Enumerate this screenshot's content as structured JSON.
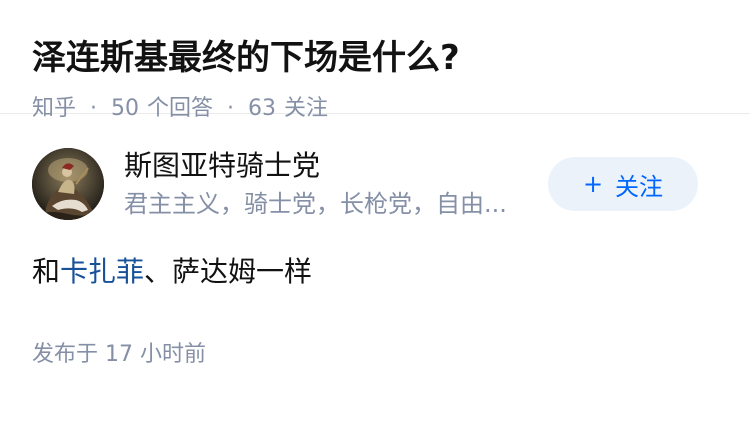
{
  "question": {
    "title": "泽连斯基最终的下场是什么?",
    "source": "知乎",
    "separator": "·",
    "answers_count": "50",
    "answers_label": "个回答",
    "followers_count": "63",
    "followers_label": "关注"
  },
  "answer": {
    "author": {
      "name": "斯图亚特骑士党",
      "bio": "君主主义，骑士党，长枪党，自由...",
      "avatar_icon": "knight-portrait-avatar"
    },
    "follow_button": {
      "plus": "+",
      "label": "关注"
    },
    "content": {
      "prefix": "和",
      "link_text": "卡扎菲",
      "suffix": "、萨达姆一样"
    },
    "time": {
      "label": "发布于",
      "value": "17 小时前"
    }
  },
  "colors": {
    "primary_text": "#121212",
    "secondary_text": "#8590a6",
    "link": "#175199",
    "button_text": "#0066ff",
    "button_bg": "#ebf2fa",
    "divider": "#ebebeb"
  }
}
